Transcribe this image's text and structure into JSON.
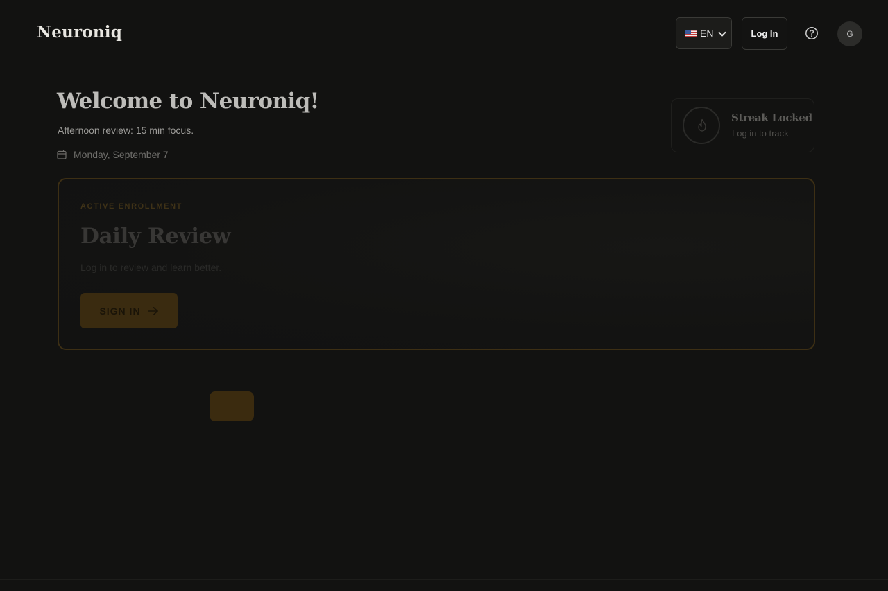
{
  "header": {
    "brand": "Neuroniq",
    "language": "EN",
    "login_label": "Log In",
    "avatar_initial": "G"
  },
  "welcome": {
    "title": "Welcome to Neuroniq!",
    "subtitle": "Afternoon review: 15 min focus.",
    "date": "Monday, September 7"
  },
  "streak": {
    "title": "Streak Locked",
    "subtitle": "Log in to track"
  },
  "enrollment": {
    "tag": "ACTIVE ENROLLMENT",
    "title": "Daily Review",
    "description": "Log in to review and learn better.",
    "button_label": "SIGN IN"
  },
  "icons": {
    "help": "help-circle-icon",
    "calendar": "calendar-icon",
    "flame": "flame-icon",
    "arrow": "arrow-right-icon",
    "language_flag": "us-flag-icon"
  },
  "colors": {
    "background": "#121211",
    "accent": "#3a2b10",
    "card_border": "#3d2f14"
  }
}
